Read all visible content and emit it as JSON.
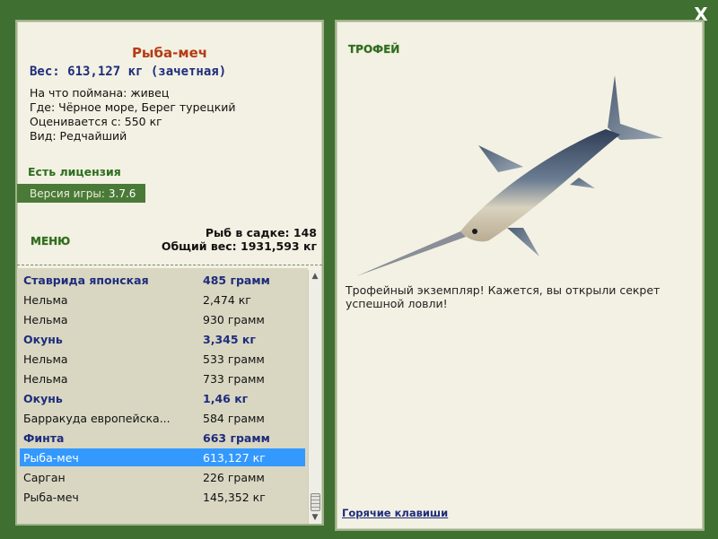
{
  "close_label": "X",
  "fish": {
    "title": "Рыба-меч",
    "weight": "Вес: 613,127 кг (зачетная)",
    "caught_on": "На что поймана: живец",
    "where": "Где: Чёрное море, Берег турецкий",
    "valued_from": "Оценивается с: 550 кг",
    "kind": "Вид: Редчайший"
  },
  "license": "Есть лицензия",
  "version": {
    "label": "Версия игры:",
    "value": "3.7.6"
  },
  "menu": "МЕНЮ",
  "stats": {
    "fish_in_keepnet": "Рыб в садке: 148",
    "total_weight": "Общий вес: 1931,593 кг"
  },
  "list": [
    {
      "name": "Ставрида японская",
      "weight": "485 грамм",
      "bold": true
    },
    {
      "name": "Нельма",
      "weight": "2,474 кг",
      "bold": false
    },
    {
      "name": "Нельма",
      "weight": "930 грамм",
      "bold": false
    },
    {
      "name": "Окунь",
      "weight": "3,345 кг",
      "bold": true
    },
    {
      "name": "Нельма",
      "weight": "533 грамм",
      "bold": false
    },
    {
      "name": "Нельма",
      "weight": "733 грамм",
      "bold": false
    },
    {
      "name": "Окунь",
      "weight": "1,46 кг",
      "bold": true
    },
    {
      "name": "Барракуда европейска...",
      "weight": "584 грамм",
      "bold": false
    },
    {
      "name": "Финта",
      "weight": "663 грамм",
      "bold": true
    },
    {
      "name": "Рыба-меч",
      "weight": "613,127 кг",
      "bold": false,
      "selected": true
    },
    {
      "name": "Сарган",
      "weight": "226 грамм",
      "bold": false
    },
    {
      "name": "Рыба-меч",
      "weight": "145,352 кг",
      "bold": false
    }
  ],
  "trophy": {
    "label": "ТРОФЕЙ",
    "text": "Трофейный экземпляр! Кажется, вы открыли секрет успешной ловли!"
  },
  "hotkeys": "Горячие клавиши",
  "colors": {
    "frame": "#3f6f31",
    "panel": "#f3f1e3",
    "selected": "#3399ff",
    "accent_title": "#b43c14",
    "accent_blue": "#1e2c7c"
  }
}
